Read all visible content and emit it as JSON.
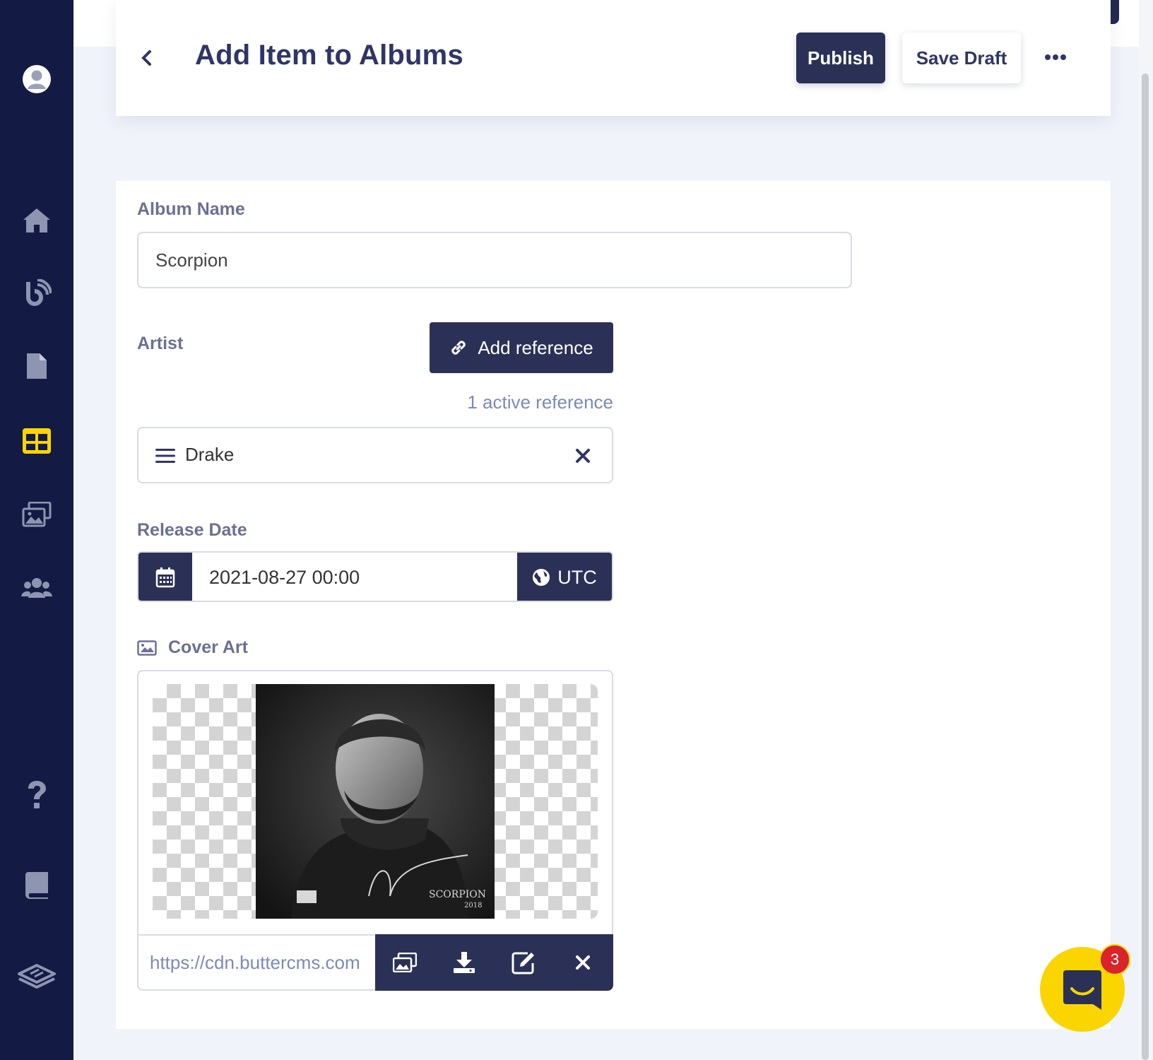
{
  "sidebar": {
    "items": [
      {
        "icon": "avatar-icon"
      },
      {
        "icon": "home-icon"
      },
      {
        "icon": "blog-icon"
      },
      {
        "icon": "page-icon"
      },
      {
        "icon": "collections-icon",
        "active": true
      },
      {
        "icon": "media-icon"
      },
      {
        "icon": "users-icon"
      },
      {
        "icon": "help-icon"
      },
      {
        "icon": "docs-icon"
      },
      {
        "icon": "logo-icon"
      }
    ],
    "active_color": "#fbd500"
  },
  "header": {
    "title": "Add Item to Albums",
    "publish_label": "Publish",
    "save_draft_label": "Save Draft"
  },
  "form": {
    "album_name": {
      "label": "Album Name",
      "value": "Scorpion"
    },
    "artist": {
      "label": "Artist",
      "add_reference_label": "Add reference",
      "active_count_text": "1 active reference",
      "references": [
        "Drake"
      ]
    },
    "release_date": {
      "label": "Release Date",
      "value": "2021-08-27 00:00",
      "timezone": "UTC"
    },
    "cover_art": {
      "label": "Cover Art",
      "url": "https://cdn.buttercms.com",
      "art_caption": "SCORPION",
      "art_year": "2018"
    }
  },
  "chat": {
    "badge_count": "3"
  },
  "colors": {
    "navy": "#131a44",
    "button": "#2b3156",
    "accent": "#fbd500",
    "badge": "#d8242a"
  }
}
